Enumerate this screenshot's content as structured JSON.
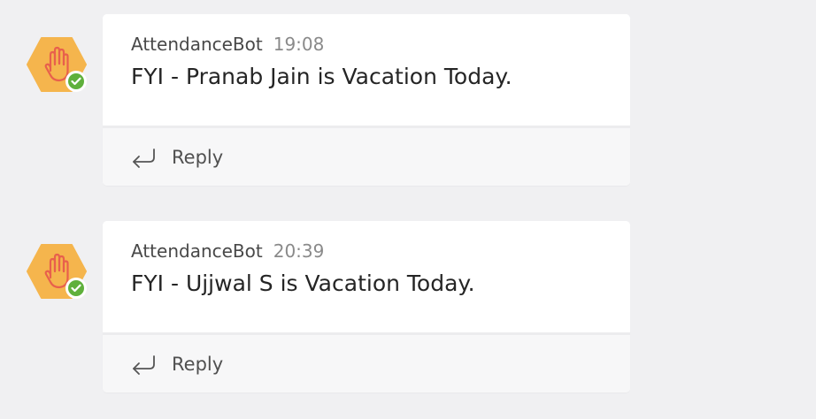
{
  "colors": {
    "background": "#f0f0f2",
    "card": "#ffffff",
    "reply_bar": "#f7f7f8",
    "avatar_orange": "#f5b54d",
    "hand_red": "#e8604c",
    "status_green": "#5fb03c"
  },
  "messages": [
    {
      "sender": "AttendanceBot",
      "time": "19:08",
      "text": "FYI - Pranab Jain is Vacation Today.",
      "reply_label": "Reply",
      "avatar_icon": "raised-hand-icon",
      "status_icon": "available-check-icon"
    },
    {
      "sender": "AttendanceBot",
      "time": "20:39",
      "text": "FYI - Ujjwal S is Vacation Today.",
      "reply_label": "Reply",
      "avatar_icon": "raised-hand-icon",
      "status_icon": "available-check-icon"
    }
  ]
}
